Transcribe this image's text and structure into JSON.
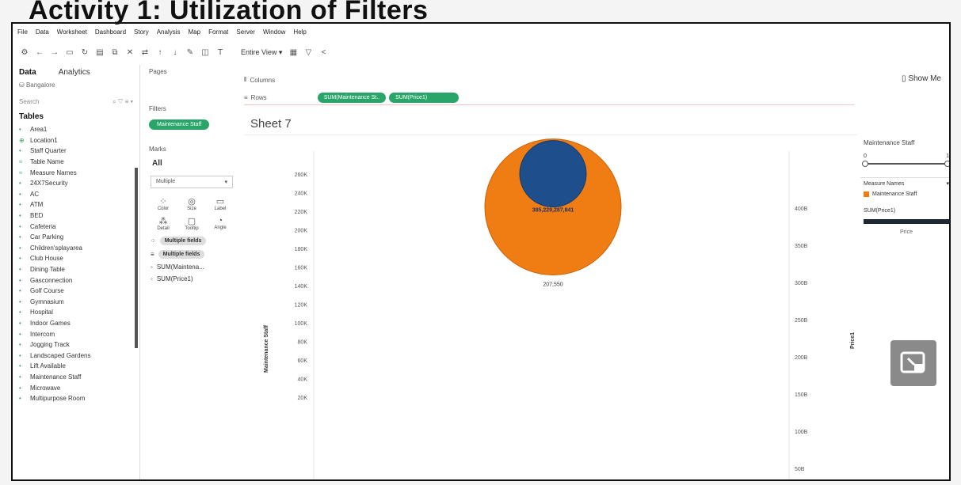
{
  "slide_title": "Activity 1: Utilization of Filters",
  "menu": [
    "File",
    "Data",
    "Worksheet",
    "Dashboard",
    "Story",
    "Analysis",
    "Map",
    "Format",
    "Server",
    "Window",
    "Help"
  ],
  "toolbar": {
    "entire_view": "Entire View"
  },
  "left_pane": {
    "tabs": [
      "Data",
      "Analytics"
    ],
    "source": "Bangalore",
    "search": "Search",
    "tables_label": "Tables",
    "fields": [
      "Area1",
      "Location1",
      "Staff Quarter",
      "Table Name",
      "Measure Names",
      "24X7Security",
      "AC",
      "ATM",
      "BED",
      "Cafeteria",
      "Car Parking",
      "Children'splayarea",
      "Club House",
      "Dining Table",
      "Gasconnection",
      "Golf Course",
      "Gymnasium",
      "Hospital",
      "Indoor Games",
      "Intercom",
      "Jogging Track",
      "Landscaped Gardens",
      "Lift Available",
      "Maintenance Staff",
      "Microwave",
      "Multipurpose Room"
    ]
  },
  "cards": {
    "pages_label": "Pages",
    "filters_label": "Filters",
    "filter_pill": "Maintenance Staff",
    "marks_label": "Marks",
    "marks_all": "All",
    "mark_type": "Multiple",
    "mark_buttons": [
      "Color",
      "Size",
      "Label",
      "Detail",
      "Tooltip",
      "Angle"
    ],
    "mark_fields": [
      "Multiple fields",
      "Multiple fields",
      "SUM(Maintena...",
      "SUM(Price1)"
    ]
  },
  "shelves": {
    "columns_label": "Columns",
    "rows_label": "Rows",
    "rows_pills": [
      "SUM(Maintenance St..",
      "SUM(Price1)"
    ]
  },
  "sheet_title": "Sheet 7",
  "show_me": "Show Me",
  "chart_data": {
    "type": "scatter",
    "left_axis": {
      "label": "Maintenance Staff",
      "ticks": [
        "260K",
        "240K",
        "220K",
        "200K",
        "180K",
        "160K",
        "140K",
        "120K",
        "100K",
        "80K",
        "60K",
        "40K",
        "20K"
      ]
    },
    "right_axis": {
      "label": "Price1",
      "ticks": [
        "400B",
        "350B",
        "300B",
        "250B",
        "200B",
        "150B",
        "100B",
        "50B"
      ]
    },
    "marks": [
      {
        "measure": "Maintenance Staff",
        "value": 207550,
        "label": "207,550",
        "color": "#f07c14"
      },
      {
        "measure": "Price1",
        "value": 385229287841,
        "label": "385,229,287,841",
        "color": "#1f4e8c"
      }
    ]
  },
  "right_pane": {
    "filter_title": "Maintenance Staff",
    "range_min": "0",
    "range_max": "1",
    "legend_title": "Measure Names",
    "legend_items": [
      {
        "label": "Maintenance Staff",
        "color": "#f07c14"
      }
    ],
    "size_title": "SUM(Price1)",
    "size_value": "Price"
  }
}
